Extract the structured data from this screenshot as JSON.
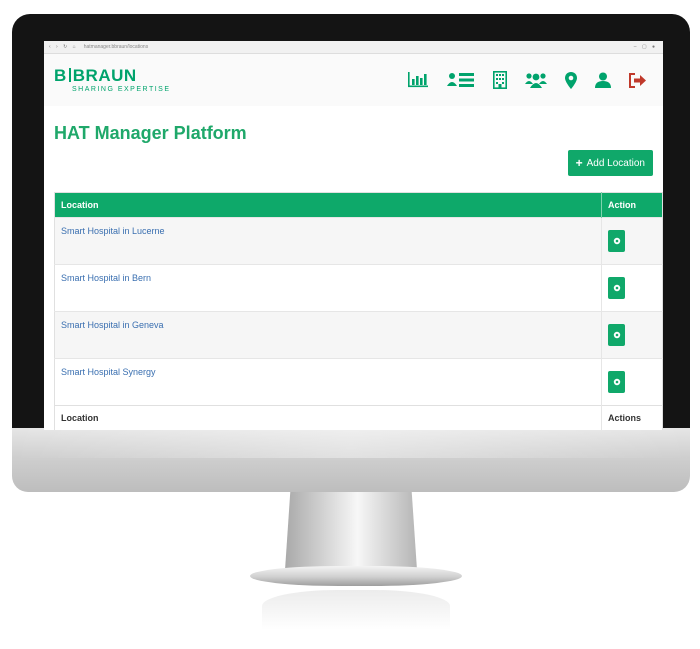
{
  "browser": {
    "nav_glyphs": "‹ › ↻ ⌂",
    "url": "hatmanager.bbraun/locations",
    "window_controls": "– ▢ ●"
  },
  "header": {
    "logo_brand_left": "B",
    "logo_brand_right": "BRAUN",
    "logo_tagline": "SHARING EXPERTISE",
    "nav_icons": [
      "bar-chart-icon",
      "id-card-list-icon",
      "building-icon",
      "users-icon",
      "map-marker-icon",
      "user-icon",
      "sign-out-icon"
    ]
  },
  "page": {
    "title": "HAT Manager Platform"
  },
  "toolbar": {
    "add_plus": "+",
    "add_label": "Add Location"
  },
  "table": {
    "headers": {
      "location": "Location",
      "action": "Action"
    },
    "rows": [
      {
        "location": "Smart Hospital in Lucerne"
      },
      {
        "location": "Smart Hospital in Bern"
      },
      {
        "location": "Smart Hospital in Geneva"
      },
      {
        "location": "Smart Hospital Synergy"
      }
    ],
    "footer": {
      "location": "Location",
      "actions": "Actions"
    }
  },
  "colors": {
    "brand_green": "#00a36c",
    "table_header": "#0ea96a",
    "link_blue": "#3a6fb0",
    "logout_red": "#c0392b"
  }
}
